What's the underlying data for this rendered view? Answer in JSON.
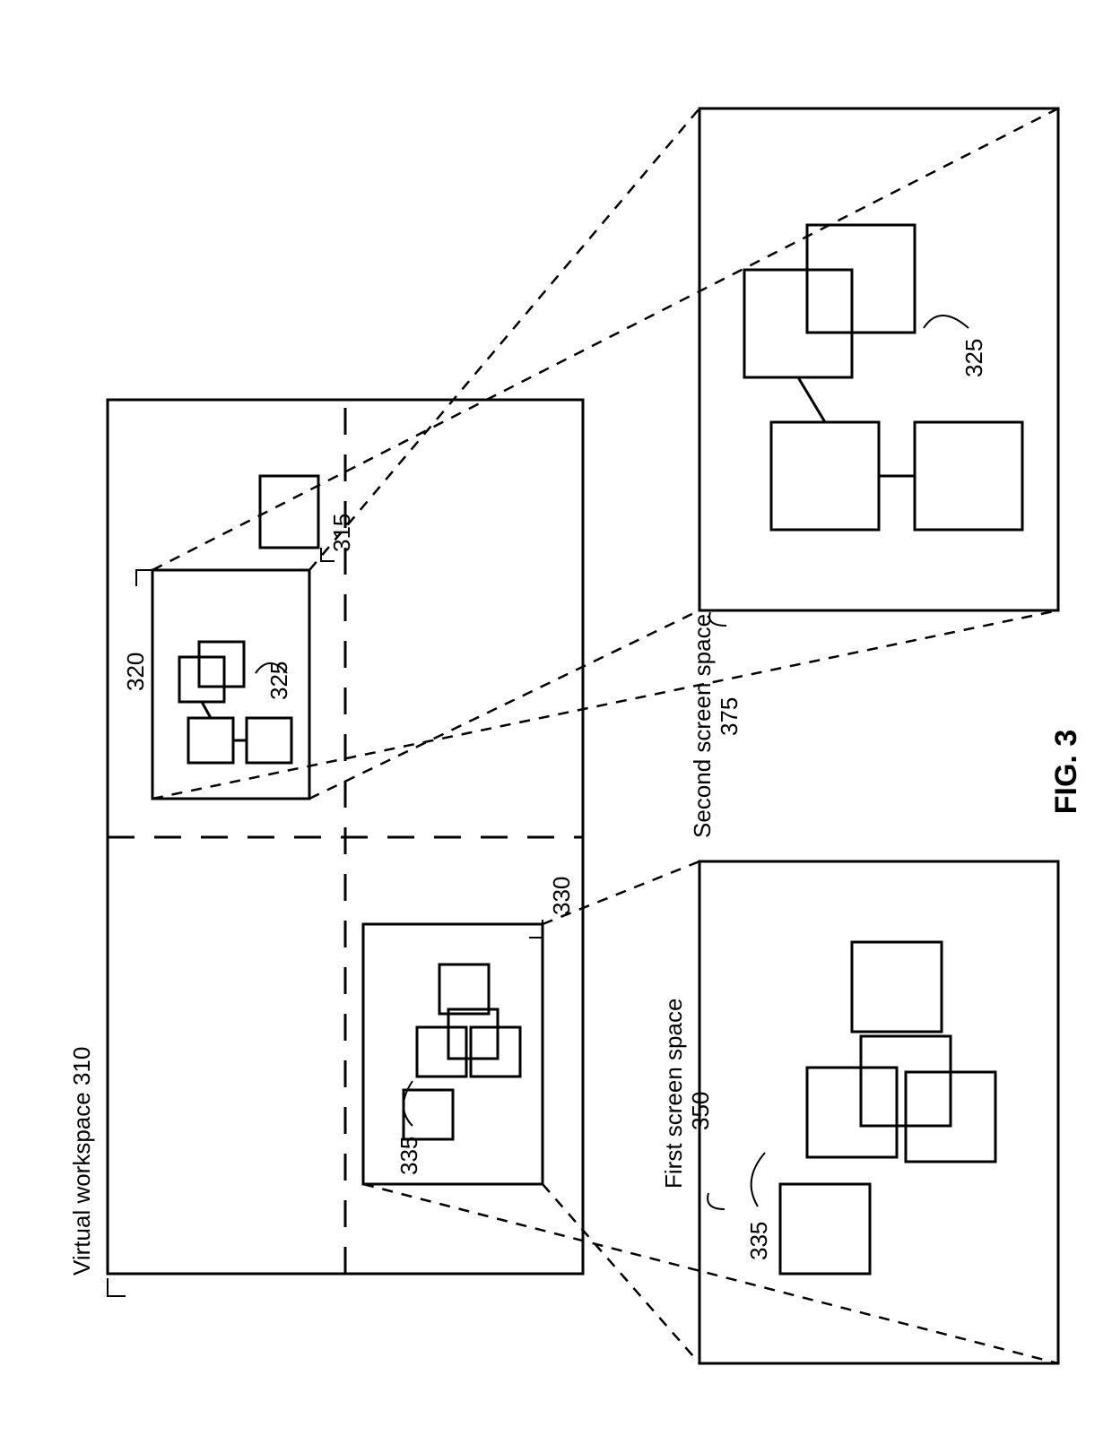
{
  "figure": "FIG. 3",
  "workspace_label": "Virtual workspace 310",
  "first_screen_label": "First screen space",
  "first_screen_num": "350",
  "second_screen_label": "Second screen space",
  "second_screen_num": "375",
  "ref_315": "315",
  "ref_320": "320",
  "ref_325a": "325",
  "ref_325b": "325",
  "ref_330": "330",
  "ref_335a": "335",
  "ref_335b": "335"
}
